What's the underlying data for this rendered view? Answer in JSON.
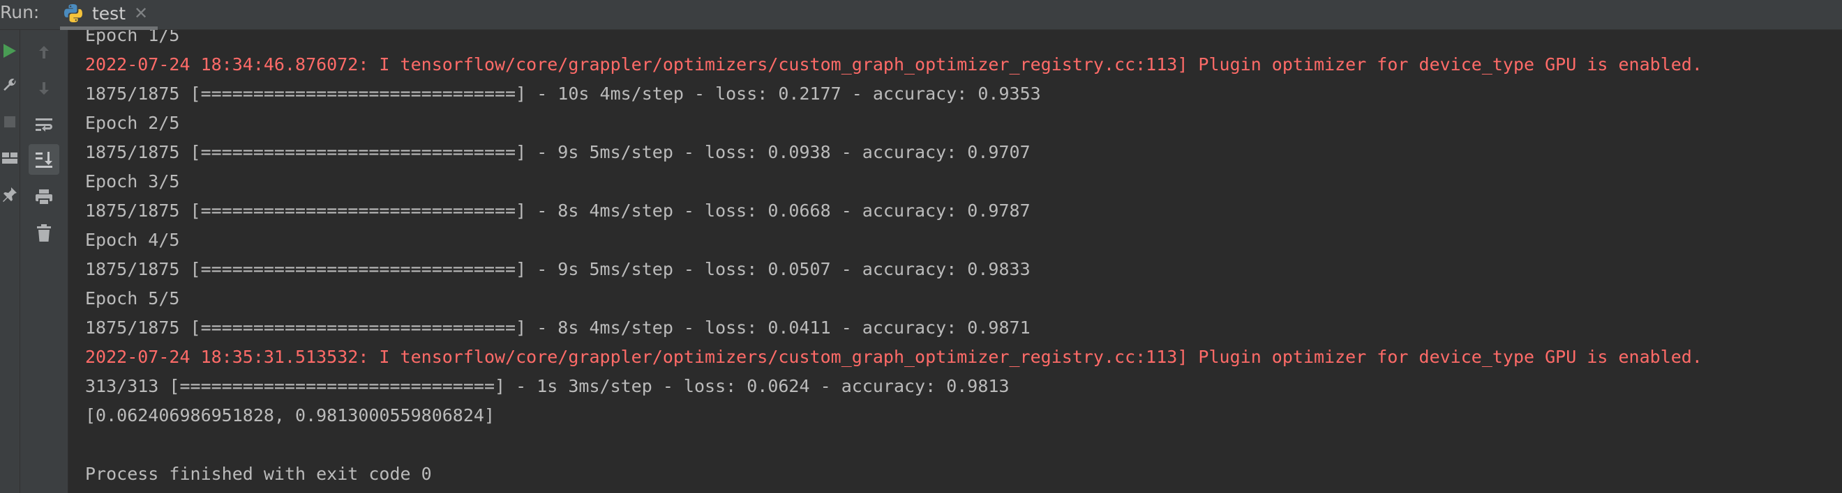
{
  "tabbar": {
    "run_label": "Run:",
    "tab_title": "test",
    "close_glyph": "✕"
  },
  "toolbar_left": {
    "icons": [
      "run-icon",
      "wrench-icon",
      "stop-icon",
      "layout-icon",
      "pin-icon"
    ]
  },
  "toolbar_right": {
    "icons": [
      "arrow-up-icon",
      "arrow-down-icon",
      "soft-wrap-icon",
      "scroll-to-end-icon",
      "print-icon",
      "trash-icon"
    ]
  },
  "console": {
    "lines": [
      {
        "text": "Epoch 1/5",
        "kind": "out"
      },
      {
        "text": "2022-07-24 18:34:46.876072: I tensorflow/core/grappler/optimizers/custom_graph_optimizer_registry.cc:113] Plugin optimizer for device_type GPU is enabled.",
        "kind": "err"
      },
      {
        "text": "1875/1875 [==============================] - 10s 4ms/step - loss: 0.2177 - accuracy: 0.9353",
        "kind": "out"
      },
      {
        "text": "Epoch 2/5",
        "kind": "out"
      },
      {
        "text": "1875/1875 [==============================] - 9s 5ms/step - loss: 0.0938 - accuracy: 0.9707",
        "kind": "out"
      },
      {
        "text": "Epoch 3/5",
        "kind": "out"
      },
      {
        "text": "1875/1875 [==============================] - 8s 4ms/step - loss: 0.0668 - accuracy: 0.9787",
        "kind": "out"
      },
      {
        "text": "Epoch 4/5",
        "kind": "out"
      },
      {
        "text": "1875/1875 [==============================] - 9s 5ms/step - loss: 0.0507 - accuracy: 0.9833",
        "kind": "out"
      },
      {
        "text": "Epoch 5/5",
        "kind": "out"
      },
      {
        "text": "1875/1875 [==============================] - 8s 4ms/step - loss: 0.0411 - accuracy: 0.9871",
        "kind": "out"
      },
      {
        "text": "2022-07-24 18:35:31.513532: I tensorflow/core/grappler/optimizers/custom_graph_optimizer_registry.cc:113] Plugin optimizer for device_type GPU is enabled.",
        "kind": "err"
      },
      {
        "text": "313/313 [==============================] - 1s 3ms/step - loss: 0.0624 - accuracy: 0.9813",
        "kind": "out"
      },
      {
        "text": "[0.062406986951828, 0.9813000559806824]",
        "kind": "out"
      },
      {
        "text": "",
        "kind": "out"
      },
      {
        "text": "Process finished with exit code 0",
        "kind": "out"
      }
    ]
  },
  "colors": {
    "stdout": "#bbbbbb",
    "stderr": "#ff6b68",
    "run_green": "#499c54"
  }
}
